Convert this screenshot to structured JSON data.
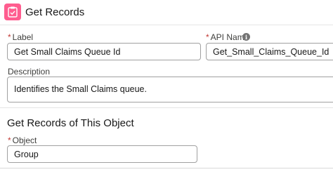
{
  "header": {
    "title": "Get Records",
    "icon": "get-records-icon",
    "icon_color": "#ff5d8f"
  },
  "form": {
    "label_field": {
      "required_mark": "*",
      "label": "Label",
      "value": "Get Small Claims Queue Id"
    },
    "api_name_field": {
      "required_mark": "*",
      "label": "API Name",
      "value": "Get_Small_Claims_Queue_Id",
      "info_icon_glyph": "i"
    },
    "description_field": {
      "label": "Description",
      "value": "Identifies the Small Claims queue."
    }
  },
  "object_section": {
    "title": "Get Records of This Object",
    "object_field": {
      "required_mark": "*",
      "label": "Object",
      "value": "Group"
    }
  },
  "colors": {
    "required": "#c23934",
    "border": "#a0a0a0"
  }
}
